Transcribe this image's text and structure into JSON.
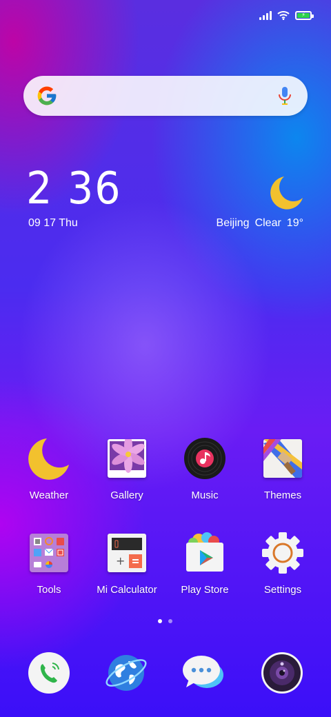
{
  "status_bar": {
    "signal_icon": "signal-icon",
    "wifi_icon": "wifi-icon",
    "battery_icon": "battery-charging-icon",
    "battery_color": "#2ed44a"
  },
  "search": {
    "logo": "google-logo-icon",
    "mic": "microphone-icon"
  },
  "clock": {
    "time": "2 36",
    "date": "09 17 Thu"
  },
  "weather": {
    "icon": "moon-icon",
    "city": "Beijing",
    "condition": "Clear",
    "temperature": "19°"
  },
  "apps": [
    {
      "label": "Weather",
      "icon": "weather-moon-icon"
    },
    {
      "label": "Gallery",
      "icon": "gallery-flower-icon"
    },
    {
      "label": "Music",
      "icon": "music-record-icon"
    },
    {
      "label": "Themes",
      "icon": "themes-brush-icon"
    },
    {
      "label": "Tools",
      "icon": "tools-folder-icon"
    },
    {
      "label": "Mi Calculator",
      "icon": "calculator-icon"
    },
    {
      "label": "Play Store",
      "icon": "play-store-icon"
    },
    {
      "label": "Settings",
      "icon": "settings-gear-icon"
    }
  ],
  "pager": {
    "pages": 2,
    "current": 1
  },
  "dock": [
    {
      "icon": "phone-icon"
    },
    {
      "icon": "browser-globe-icon"
    },
    {
      "icon": "messages-icon"
    },
    {
      "icon": "camera-icon"
    }
  ],
  "colors": {
    "moon_yellow": "#f2c12e",
    "calculator_orange": "#f46b4c",
    "settings_orange": "#d9782a"
  }
}
